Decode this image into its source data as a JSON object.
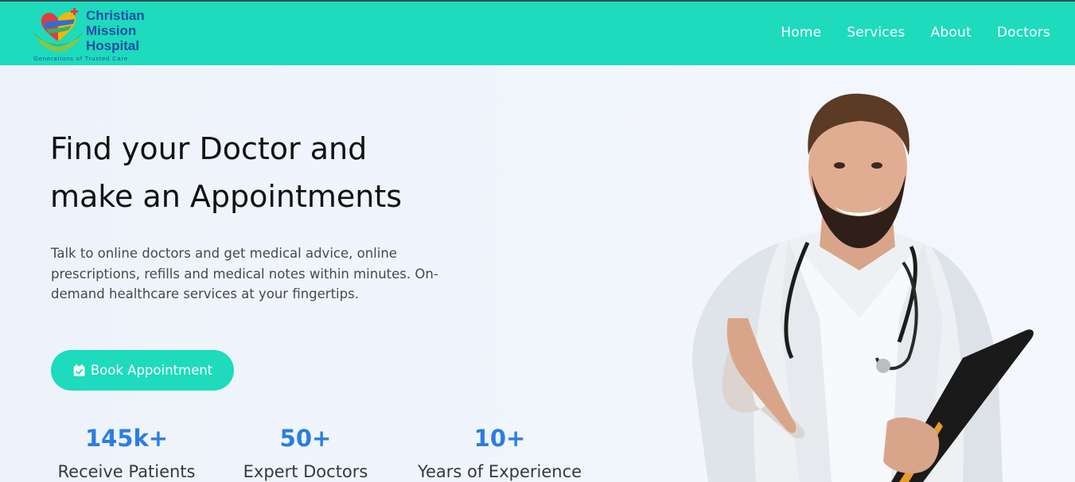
{
  "brand": {
    "name_lines": [
      "Christian",
      "Mission",
      "Hospital"
    ],
    "tagline": "Generations of Trusted Care"
  },
  "nav": {
    "items": [
      {
        "label": "Home"
      },
      {
        "label": "Services"
      },
      {
        "label": "About"
      },
      {
        "label": "Doctors"
      }
    ]
  },
  "hero": {
    "title_lines": [
      "Find your Doctor and",
      "make an Appointments"
    ],
    "description": "Talk to online doctors and get medical advice, online prescriptions, refills and medical notes within minutes. On-demand healthcare services at your fingertips.",
    "cta_label": "Book Appointment",
    "cta_icon": "calendar-check-icon"
  },
  "stats": [
    {
      "value": "145k+",
      "label": "Receive Patients"
    },
    {
      "value": "50+",
      "label": "Expert Doctors"
    },
    {
      "value": "10+",
      "label": "Years of Experience"
    }
  ],
  "colors": {
    "accent": "#1ddbbc",
    "stat_blue": "#2a7ee0",
    "brand_blue": "#1f4fa6"
  }
}
